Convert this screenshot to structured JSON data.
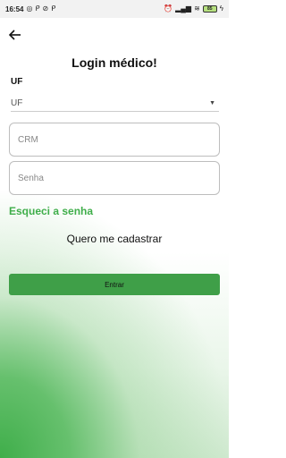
{
  "status_bar": {
    "time": "16:54",
    "left_icons": [
      "whatsapp-icon",
      "p-notification-icon",
      "compass-icon",
      "p-notification-icon"
    ],
    "right_icons": [
      "alarm-icon",
      "signal-icon",
      "wifi-icon"
    ],
    "battery": "85"
  },
  "header": {
    "back_icon": "arrow-left-icon",
    "title": "Login médico!"
  },
  "form": {
    "uf_label": "UF",
    "uf_select_value": "UF",
    "crm_placeholder": "CRM",
    "senha_placeholder": "Senha",
    "forgot_label": "Esqueci a senha",
    "register_label": "Quero me cadastrar",
    "submit_label": "Entrar"
  },
  "colors": {
    "accent_green": "#3fae4a",
    "button_green": "#3f9f48"
  }
}
